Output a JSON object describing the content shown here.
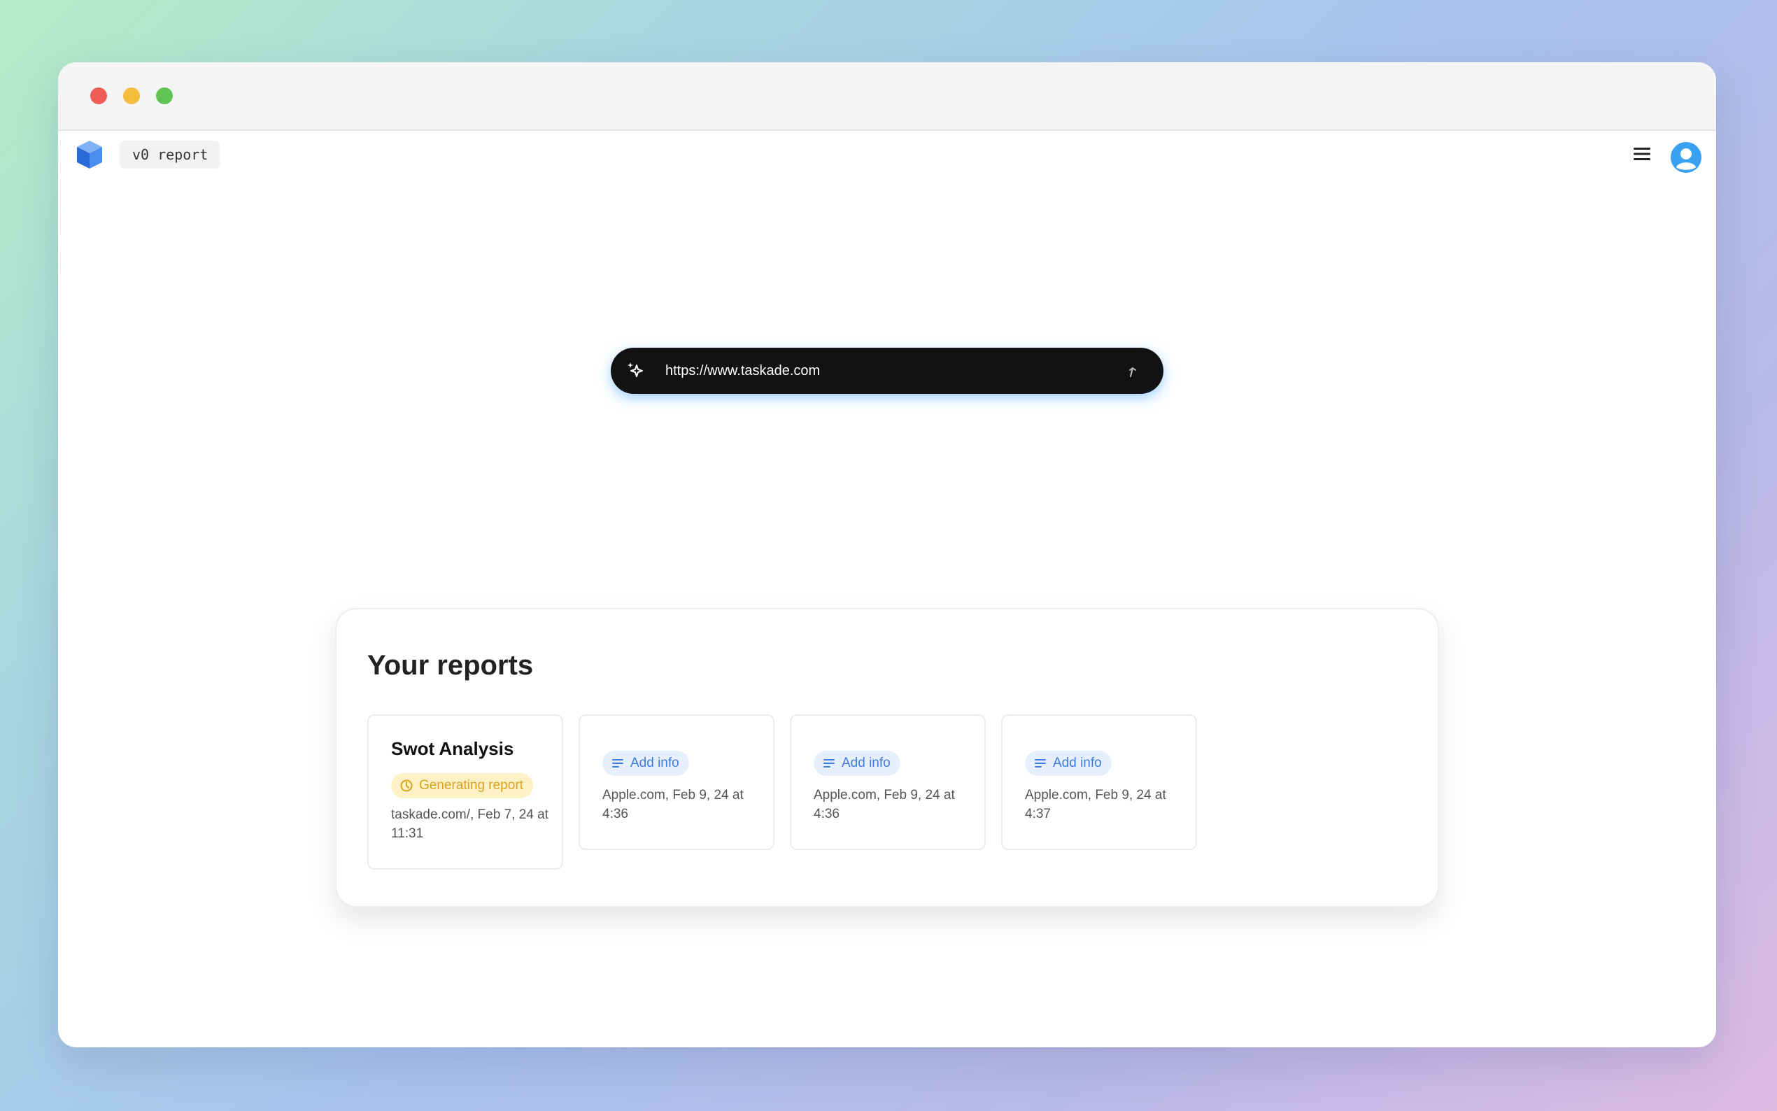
{
  "app": {
    "tag_label": "v0 report",
    "accent_color": "#3f7be0",
    "logo_icon": "cube-logo-icon",
    "menu_icon": "hamburger-menu-icon",
    "avatar_icon": "user-avatar-icon"
  },
  "url_bar": {
    "value": "https://www.taskade.com",
    "leading_icon": "sparkles-icon",
    "trailing_icon": "submit-arrow-icon"
  },
  "reports": {
    "title": "Your reports",
    "cards": [
      {
        "title": "Swot Analysis",
        "badge": "Generating report",
        "badge_icon": "spinner-icon",
        "meta": "taskade.com/, Feb 7, 24 at 11:31"
      },
      {
        "badge": "Add info",
        "badge_icon": "lines-icon",
        "meta": "Apple.com, Feb 9, 24 at 4:36"
      },
      {
        "badge": "Add info",
        "badge_icon": "lines-icon",
        "meta": "Apple.com, Feb 9, 24 at 4:36"
      },
      {
        "badge": "Add info",
        "badge_icon": "lines-icon",
        "meta": "Apple.com, Feb 9, 24 at 4:37"
      }
    ]
  }
}
